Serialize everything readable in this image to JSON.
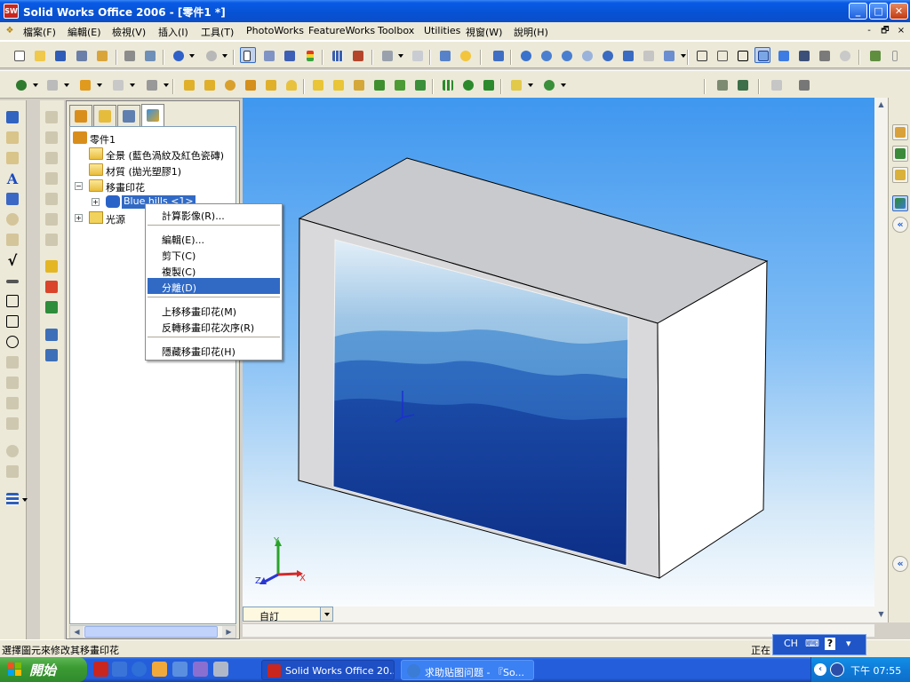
{
  "window": {
    "app_icon": "SW",
    "title": "Solid Works Office 2006 - [零件1 *]",
    "buttons": {
      "minimize": "_",
      "maximize": "□",
      "close": "✕"
    }
  },
  "menu": {
    "items": [
      "檔案(F)",
      "編輯(E)",
      "檢視(V)",
      "插入(I)",
      "工具(T)",
      "PhotoWorks",
      "FeatureWorks",
      "Toolbox",
      "Utilities",
      "視窗(W)",
      "說明(H)"
    ],
    "doc_controls": [
      "-",
      "🗗",
      "×"
    ]
  },
  "feature_manager": {
    "tabs": [
      "featuremanager-tab-icon",
      "propertymanager-tab-icon",
      "configurationmanager-tab-icon",
      "photoworks-tab-icon"
    ],
    "tree": [
      {
        "label": "零件1",
        "level": 0,
        "expander": "",
        "icon": "part-icon"
      },
      {
        "label": "全景 (藍色渦紋及紅色瓷磚)",
        "level": 1,
        "expander": "",
        "icon": "folder-icon"
      },
      {
        "label": "材質 (拋光塑膠1)",
        "level": 1,
        "expander": "",
        "icon": "folder-icon"
      },
      {
        "label": "移畫印花",
        "level": 1,
        "expander": "−",
        "icon": "folder-icon"
      },
      {
        "label": "Blue hills <1>",
        "level": 2,
        "expander": "+",
        "icon": "decal-icon"
      },
      {
        "label": "光源",
        "level": 1,
        "expander": "+",
        "icon": "lights-icon"
      }
    ],
    "scroll_left": "◀",
    "scroll_right": "▶"
  },
  "context_menu": {
    "items": [
      {
        "label": "計算影像(R)...",
        "highlighted": false
      },
      {
        "label": "編輯(E)...",
        "highlighted": false,
        "sep_before": true
      },
      {
        "label": "剪下(C)",
        "highlighted": false
      },
      {
        "label": "複製(C)",
        "highlighted": false
      },
      {
        "label": "分離(D)",
        "highlighted": true
      },
      {
        "label": "上移移畫印花(M)",
        "highlighted": false,
        "sep_before": true
      },
      {
        "label": "反轉移畫印花次序(R)",
        "highlighted": false
      },
      {
        "label": "隱藏移畫印花(H)",
        "highlighted": false,
        "sep_before": true
      }
    ]
  },
  "viewport": {
    "triad": {
      "x": "X",
      "y": "Y",
      "z": "Z"
    },
    "config": "自訂",
    "config_caret": "▾",
    "scroll_up": "▲",
    "scroll_down": "▼",
    "collapse_icon": "«"
  },
  "status": {
    "message": "選擇圖元來修改其移畫印花",
    "right_text": "正在"
  },
  "langbar": {
    "lang": "CH",
    "keyboard": "⌨",
    "help": "?",
    "caret": "▾"
  },
  "taskbar": {
    "start_label": "開始",
    "tasks": [
      {
        "label": "Solid Works Office 20...",
        "icon": "solidworks-icon",
        "active": true
      },
      {
        "label": "求助贴图问题 - 『So...",
        "icon": "ie-icon",
        "active": false
      }
    ],
    "clock": "下午 07:55",
    "tray_icons": [
      "back-arrow-icon",
      "network-icon",
      "audio-icon"
    ]
  },
  "colors": {
    "accent": "#316ac5",
    "titlebar": "#0653d6",
    "viewport_top": "#3f97ef",
    "viewport_bottom": "#ffffff",
    "taskbar": "#245edb",
    "start": "#3d9c34"
  }
}
